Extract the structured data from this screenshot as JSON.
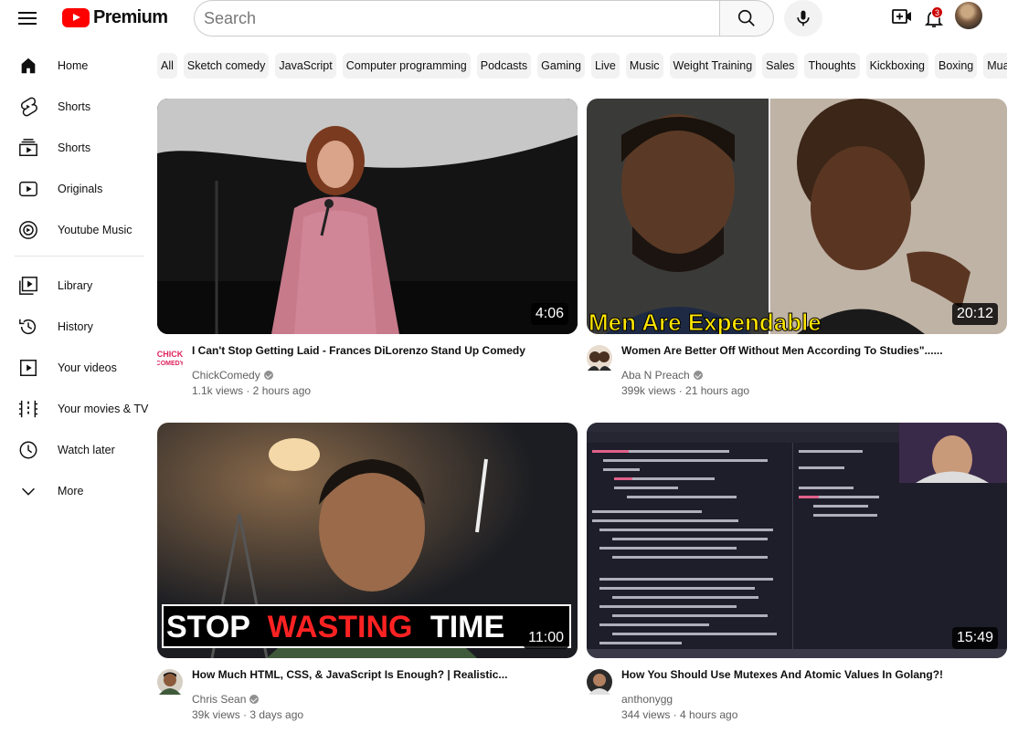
{
  "header": {
    "logo_text": "Premium",
    "search_placeholder": "Search",
    "notification_count": "3",
    "icons": [
      "menu-icon",
      "youtube-logo",
      "search-icon",
      "mic-icon",
      "create-icon",
      "bell-icon"
    ]
  },
  "sidebar": {
    "items": [
      {
        "label": "Home",
        "icon": "home-icon"
      },
      {
        "label": "Shorts",
        "icon": "shorts-icon"
      },
      {
        "label": "Shorts",
        "icon": "subscriptions-icon"
      },
      {
        "label": "Originals",
        "icon": "originals-icon"
      },
      {
        "label": "Youtube Music",
        "icon": "music-icon"
      },
      {
        "label": "Library",
        "icon": "library-icon"
      },
      {
        "label": "History",
        "icon": "history-icon"
      },
      {
        "label": "Your videos",
        "icon": "your-videos-icon"
      },
      {
        "label": "Your movies & TV",
        "icon": "movies-icon"
      },
      {
        "label": "Watch later",
        "icon": "watch-later-icon"
      },
      {
        "label": "More",
        "icon": "chevron-down-icon"
      }
    ]
  },
  "chips": [
    "All",
    "Sketch comedy",
    "JavaScript",
    "Computer programming",
    "Podcasts",
    "Gaming",
    "Live",
    "Music",
    "Weight Training",
    "Sales",
    "Thoughts",
    "Kickboxing",
    "Boxing",
    "Muay Thai"
  ],
  "videos": [
    {
      "title": "I Can't Stop Getting Laid - Frances DiLorenzo Stand Up Comedy",
      "channel": "ChickComedy",
      "meta": "1.1k views · 2 hours ago",
      "duration": "4:06",
      "verified": true,
      "thumb_text": "",
      "chan_text": "CHICK COMEDY"
    },
    {
      "title": "Women Are Better Off Without Men According To Studies\"......",
      "channel": "Aba N Preach",
      "meta": "399k views · 21 hours ago",
      "duration": "20:12",
      "verified": true,
      "thumb_text": "Men Are Expendable"
    },
    {
      "title": "How Much HTML, CSS, & JavaScript Is Enough? | Realistic...",
      "channel": "Chris Sean",
      "meta": "39k views · 3 days ago",
      "duration": "11:00",
      "verified": true,
      "thumb_text_a": "STOP",
      "thumb_text_b": "WASTING",
      "thumb_text_c": "TIME"
    },
    {
      "title": "How You Should Use Mutexes And Atomic Values In Golang?!",
      "channel": "anthonygg",
      "meta": "344 views · 4 hours ago",
      "duration": "15:49",
      "verified": false
    }
  ],
  "colors": {
    "brand": "#ff0000",
    "chip_bg": "#f2f2f2",
    "secondary_text": "#606060",
    "thumb_caption_yellow": "#ffe600",
    "thumb_caption_red": "#ff2222"
  }
}
